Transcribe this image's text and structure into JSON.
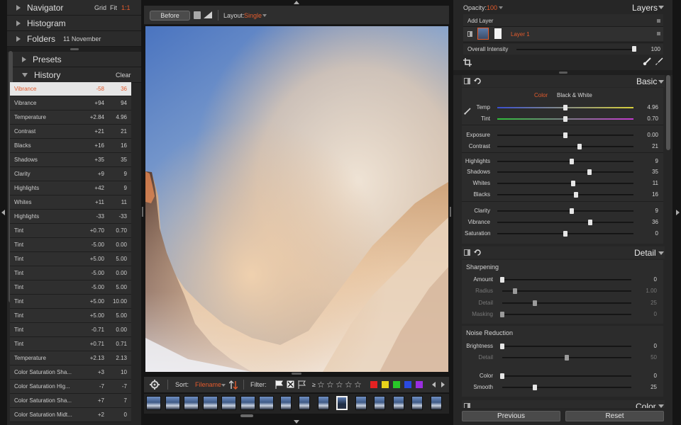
{
  "left_panel": {
    "navigator": {
      "title": "Navigator",
      "grid": "Grid",
      "fit": "Fit",
      "ratio": "1:1"
    },
    "histogram": {
      "title": "Histogram"
    },
    "folders": {
      "title": "Folders",
      "current": "11 November"
    },
    "presets": {
      "title": "Presets"
    },
    "history": {
      "title": "History",
      "clear": "Clear",
      "rows": [
        {
          "name": "Vibrance",
          "delta": "-58",
          "value": "36"
        },
        {
          "name": "Vibrance",
          "delta": "+94",
          "value": "94"
        },
        {
          "name": "Temperature",
          "delta": "+2.84",
          "value": "4.96"
        },
        {
          "name": "Contrast",
          "delta": "+21",
          "value": "21"
        },
        {
          "name": "Blacks",
          "delta": "+16",
          "value": "16"
        },
        {
          "name": "Shadows",
          "delta": "+35",
          "value": "35"
        },
        {
          "name": "Clarity",
          "delta": "+9",
          "value": "9"
        },
        {
          "name": "Highlights",
          "delta": "+42",
          "value": "9"
        },
        {
          "name": "Whites",
          "delta": "+11",
          "value": "11"
        },
        {
          "name": "Highlights",
          "delta": "-33",
          "value": "-33"
        },
        {
          "name": "Tint",
          "delta": "+0.70",
          "value": "0.70"
        },
        {
          "name": "Tint",
          "delta": "-5.00",
          "value": "0.00"
        },
        {
          "name": "Tint",
          "delta": "+5.00",
          "value": "5.00"
        },
        {
          "name": "Tint",
          "delta": "-5.00",
          "value": "0.00"
        },
        {
          "name": "Tint",
          "delta": "-5.00",
          "value": "5.00"
        },
        {
          "name": "Tint",
          "delta": "+5.00",
          "value": "10.00"
        },
        {
          "name": "Tint",
          "delta": "+5.00",
          "value": "5.00"
        },
        {
          "name": "Tint",
          "delta": "-0.71",
          "value": "0.00"
        },
        {
          "name": "Tint",
          "delta": "+0.71",
          "value": "0.71"
        },
        {
          "name": "Temperature",
          "delta": "+2.13",
          "value": "2.13"
        },
        {
          "name": "Color Saturation Sha...",
          "delta": "+3",
          "value": "10"
        },
        {
          "name": "Color Saturation Hig...",
          "delta": "-7",
          "value": "-7"
        },
        {
          "name": "Color Saturation Sha...",
          "delta": "+7",
          "value": "7"
        },
        {
          "name": "Color Saturation Midt...",
          "delta": "+2",
          "value": "0"
        }
      ]
    }
  },
  "toolbar": {
    "before": "Before",
    "layout_label": "Layout:",
    "layout_value": "Single"
  },
  "filmbar": {
    "sort_label": "Sort:",
    "sort_value": "Filename",
    "filter_label": "Filter:",
    "rating_prefix": "≥",
    "stars": 5
  },
  "filter_colors": [
    "#e52222",
    "#e8d21a",
    "#28c828",
    "#2a4ae0",
    "#9b2ee0"
  ],
  "filmstrip": {
    "count": 16,
    "selected": 10
  },
  "right_panel": {
    "layers": {
      "opacity_label": "Opacity:",
      "opacity_value": "100",
      "title": "Layers",
      "add_layer": "Add Layer",
      "layer_name": "Layer 1",
      "intensity_label": "Overall Intensity",
      "intensity_value": "100",
      "intensity_level": 1.0
    },
    "basic": {
      "title": "Basic",
      "tab_color": "Color",
      "tab_bw": "Black & White",
      "sliders": [
        {
          "label": "Temp",
          "value": "4.96",
          "pos": 0.5
        },
        {
          "label": "Tint",
          "value": "0.70",
          "pos": 0.5
        },
        {
          "label": "Exposure",
          "value": "0.00",
          "pos": 0.5
        },
        {
          "label": "Contrast",
          "value": "21",
          "pos": 0.605
        },
        {
          "label": "Highlights",
          "value": "9",
          "pos": 0.545
        },
        {
          "label": "Shadows",
          "value": "35",
          "pos": 0.675
        },
        {
          "label": "Whites",
          "value": "11",
          "pos": 0.555
        },
        {
          "label": "Blacks",
          "value": "16",
          "pos": 0.58
        },
        {
          "label": "Clarity",
          "value": "9",
          "pos": 0.545
        },
        {
          "label": "Vibrance",
          "value": "36",
          "pos": 0.68
        },
        {
          "label": "Saturation",
          "value": "0",
          "pos": 0.5
        }
      ]
    },
    "detail": {
      "title": "Detail",
      "sharpening": "Sharpening",
      "sharp_sliders": [
        {
          "label": "Amount",
          "value": "0",
          "pos": 0.0,
          "dim": false
        },
        {
          "label": "Radius",
          "value": "1.00",
          "pos": 0.1,
          "dim": true
        },
        {
          "label": "Detail",
          "value": "25",
          "pos": 0.25,
          "dim": true
        },
        {
          "label": "Masking",
          "value": "0",
          "pos": 0.0,
          "dim": true
        }
      ],
      "noise": "Noise Reduction",
      "noise_sliders": [
        {
          "label": "Brightness",
          "value": "0",
          "pos": 0.0,
          "dim": false
        },
        {
          "label": "Detail",
          "value": "50",
          "pos": 0.5,
          "dim": true
        },
        {
          "label": "Color",
          "value": "0",
          "pos": 0.0,
          "dim": false
        },
        {
          "label": "Smooth",
          "value": "25",
          "pos": 0.25,
          "dim": false
        }
      ]
    },
    "color": {
      "title": "Color"
    },
    "buttons": {
      "previous": "Previous",
      "reset": "Reset"
    }
  }
}
